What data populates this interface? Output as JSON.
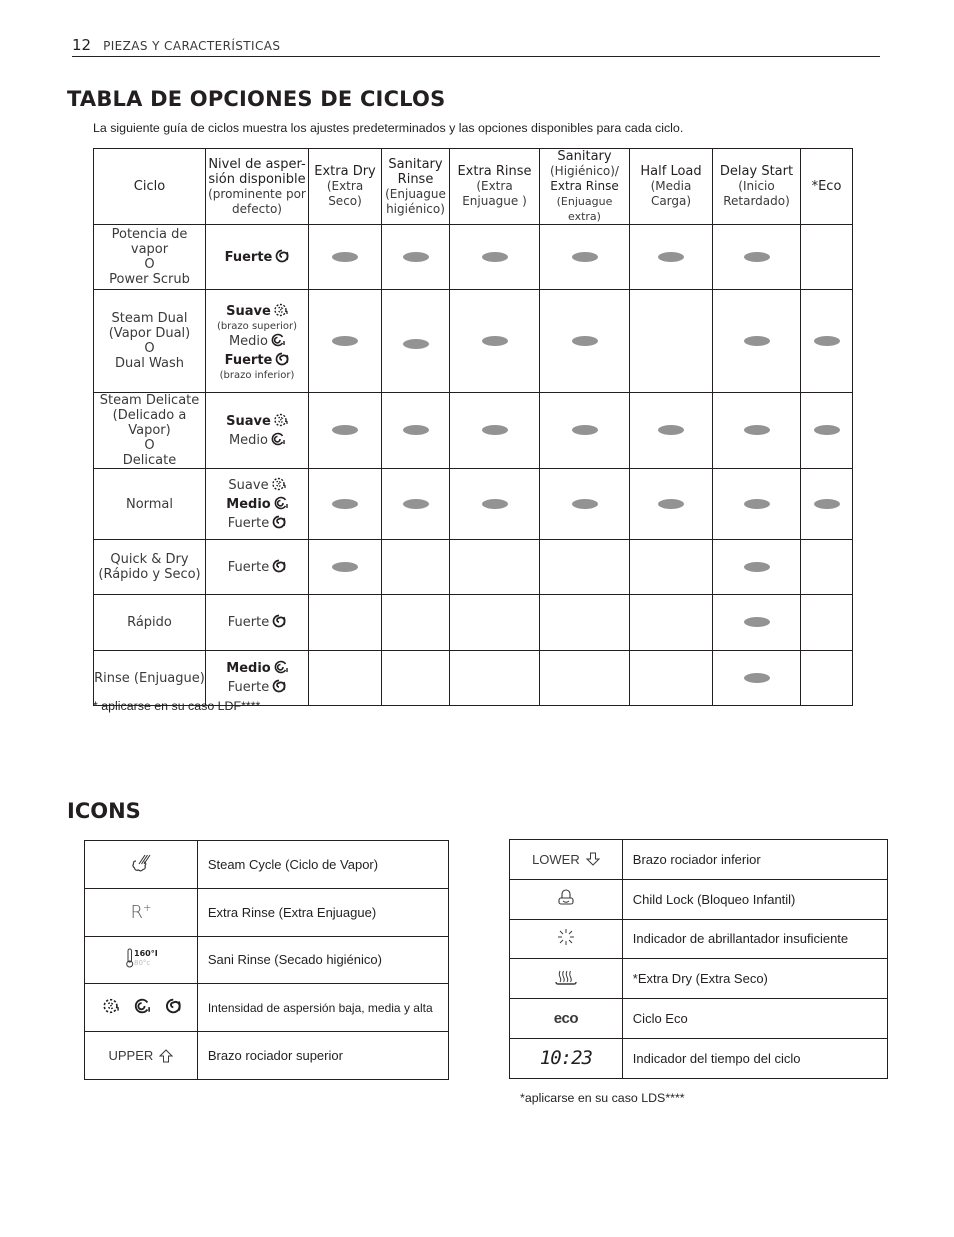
{
  "header": {
    "page_number": "12",
    "section": "PIEZAS Y CARACTERÍSTICAS"
  },
  "title": "TABLA DE OPCIONES DE CICLOS",
  "intro": "La siguiente guía de ciclos muestra los ajustes predeterminados y las opciones disponibles para cada ciclo.",
  "table": {
    "columns": [
      {
        "main": "Ciclo",
        "sub": ""
      },
      {
        "main": "Nivel de asper-sión disponible",
        "sub": "(prominente por defecto)"
      },
      {
        "main": "Extra Dry",
        "sub": "(Extra Seco)"
      },
      {
        "main": "Sanitary Rinse",
        "sub": "(Enjuague higiénico)"
      },
      {
        "main": "Extra Rinse",
        "sub": "(Extra Enjuague )"
      },
      {
        "main": "Sanitary",
        "sub": "(Higiénico)/",
        "main2": "Extra Rinse",
        "sub2": "(Enjuague extra)"
      },
      {
        "main": "Half Load",
        "sub": "(Media Carga)"
      },
      {
        "main": "Delay Start",
        "sub": "(Inicio Retardado)"
      },
      {
        "main": "*Eco",
        "sub": ""
      }
    ],
    "rows": [
      {
        "cycle": [
          "Potencia de vapor",
          "O",
          "Power Scrub"
        ],
        "levels": [
          {
            "label": "Fuerte",
            "icon": "spray-high-icon",
            "bold": true,
            "note": ""
          }
        ],
        "options": [
          true,
          true,
          true,
          true,
          true,
          true,
          false
        ]
      },
      {
        "cycle": [
          "Steam Dual",
          "(Vapor Dual)",
          "O",
          "Dual Wash"
        ],
        "levels": [
          {
            "label": "Suave",
            "icon": "spray-low-icon",
            "bold": true,
            "note": "(brazo superior)"
          },
          {
            "label": "Medio",
            "icon": "spray-medium-icon",
            "bold": false,
            "note": ""
          },
          {
            "label": "Fuerte",
            "icon": "spray-high-icon",
            "bold": true,
            "note": "(brazo inferior)"
          }
        ],
        "options": [
          true,
          true,
          true,
          true,
          false,
          true,
          true
        ]
      },
      {
        "cycle": [
          "Steam Delicate",
          "(Delicado a Vapor)",
          "O",
          "Delicate"
        ],
        "levels": [
          {
            "label": "Suave",
            "icon": "spray-low-icon",
            "bold": true,
            "note": ""
          },
          {
            "label": "Medio",
            "icon": "spray-medium-icon",
            "bold": false,
            "note": ""
          }
        ],
        "options": [
          true,
          true,
          true,
          true,
          true,
          true,
          true
        ]
      },
      {
        "cycle": [
          "Normal"
        ],
        "levels": [
          {
            "label": "Suave",
            "icon": "spray-low-icon",
            "bold": false,
            "note": ""
          },
          {
            "label": "Medio",
            "icon": "spray-medium-icon",
            "bold": true,
            "note": ""
          },
          {
            "label": "Fuerte",
            "icon": "spray-high-icon",
            "bold": false,
            "note": ""
          }
        ],
        "options": [
          true,
          true,
          true,
          true,
          true,
          true,
          true
        ]
      },
      {
        "cycle": [
          "Quick & Dry",
          "(Rápido y Seco)"
        ],
        "levels": [
          {
            "label": "Fuerte",
            "icon": "spray-high-icon",
            "bold": false,
            "note": ""
          }
        ],
        "options": [
          true,
          false,
          false,
          false,
          false,
          true,
          false
        ]
      },
      {
        "cycle": [
          "Rápido"
        ],
        "levels": [
          {
            "label": "Fuerte",
            "icon": "spray-high-icon",
            "bold": false,
            "note": ""
          }
        ],
        "options": [
          false,
          false,
          false,
          false,
          false,
          true,
          false
        ]
      },
      {
        "cycle": [
          "Rinse (Enjuague)"
        ],
        "levels": [
          {
            "label": "Medio",
            "icon": "spray-medium-icon",
            "bold": true,
            "note": ""
          },
          {
            "label": "Fuerte",
            "icon": "spray-high-icon",
            "bold": false,
            "note": ""
          }
        ],
        "options": [
          false,
          false,
          false,
          false,
          false,
          true,
          false
        ]
      }
    ]
  },
  "note_ldf": "* aplicarse en su caso LDF****",
  "icons_title": "ICONS",
  "icons_left": [
    {
      "icon": "steam-cycle-icon",
      "label": "",
      "desc": "Steam Cycle (Ciclo de Vapor)"
    },
    {
      "icon": "extra-rinse-icon",
      "label": "R",
      "desc": "Extra Rinse (Extra Enjuague)"
    },
    {
      "icon": "sani-rinse-icon",
      "label": "160°F / 80°C",
      "desc": "Sani Rinse (Secado higiénico)"
    },
    {
      "icon": "spray-intensity-icons",
      "label": "",
      "desc": "Intensidad de aspersión baja, media y alta"
    },
    {
      "icon": "upper-arrow-icon",
      "label": "UPPER",
      "desc": "Brazo rociador superior"
    }
  ],
  "icons_right": [
    {
      "icon": "lower-arrow-icon",
      "label": "LOWER",
      "desc": "Brazo rociador inferior"
    },
    {
      "icon": "child-lock-icon",
      "label": "",
      "desc": "Child Lock (Bloqueo Infantil)"
    },
    {
      "icon": "rinse-aid-icon",
      "label": "",
      "desc": "Indicador de abrillantador insuficiente"
    },
    {
      "icon": "extra-dry-icon",
      "label": "",
      "desc": "*Extra Dry (Extra Seco)"
    },
    {
      "icon": "eco-icon",
      "label": "eco",
      "desc": "Ciclo Eco"
    },
    {
      "icon": "cycle-time-icon",
      "label": "10:23",
      "desc": "Indicador del tiempo del ciclo"
    }
  ],
  "note_lds": "*aplicarse en su caso LDS****"
}
